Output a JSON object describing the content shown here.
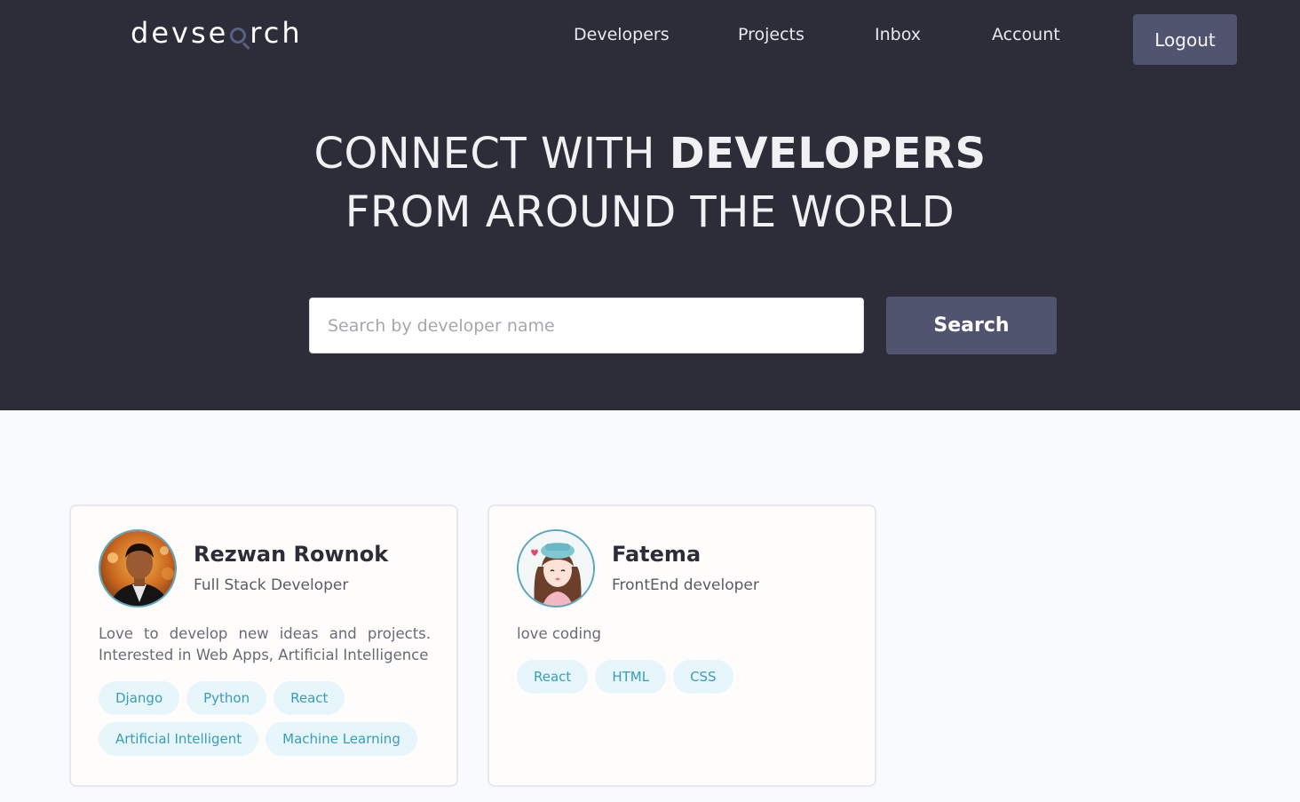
{
  "brand": {
    "logo_before": "devse",
    "logo_after": "rch"
  },
  "nav": {
    "developers": "Developers",
    "projects": "Projects",
    "inbox": "Inbox",
    "account": "Account",
    "logout": "Logout"
  },
  "hero": {
    "line1_light": "CONNECT WITH ",
    "line1_bold": "DEVELOPERS",
    "line2": "FROM AROUND THE WORLD"
  },
  "search": {
    "placeholder": "Search by developer name",
    "value": "",
    "button_label": "Search"
  },
  "colors": {
    "header_bg": "#2d2d39",
    "accent": "#51546e",
    "tag_bg": "#e6f6fa",
    "tag_text": "#3b9cb8"
  },
  "developers": [
    {
      "name": "Rezwan Rownok",
      "role": "Full Stack Developer",
      "bio": "Love to develop new ideas and projects. Interested in Web Apps, Artificial Intelligence",
      "skills": [
        "Django",
        "Python",
        "React",
        "Artificial Intelligent",
        "Machine Learning"
      ]
    },
    {
      "name": "Fatema",
      "role": "FrontEnd developer",
      "bio": "love coding",
      "skills": [
        "React",
        "HTML",
        "CSS"
      ]
    }
  ]
}
